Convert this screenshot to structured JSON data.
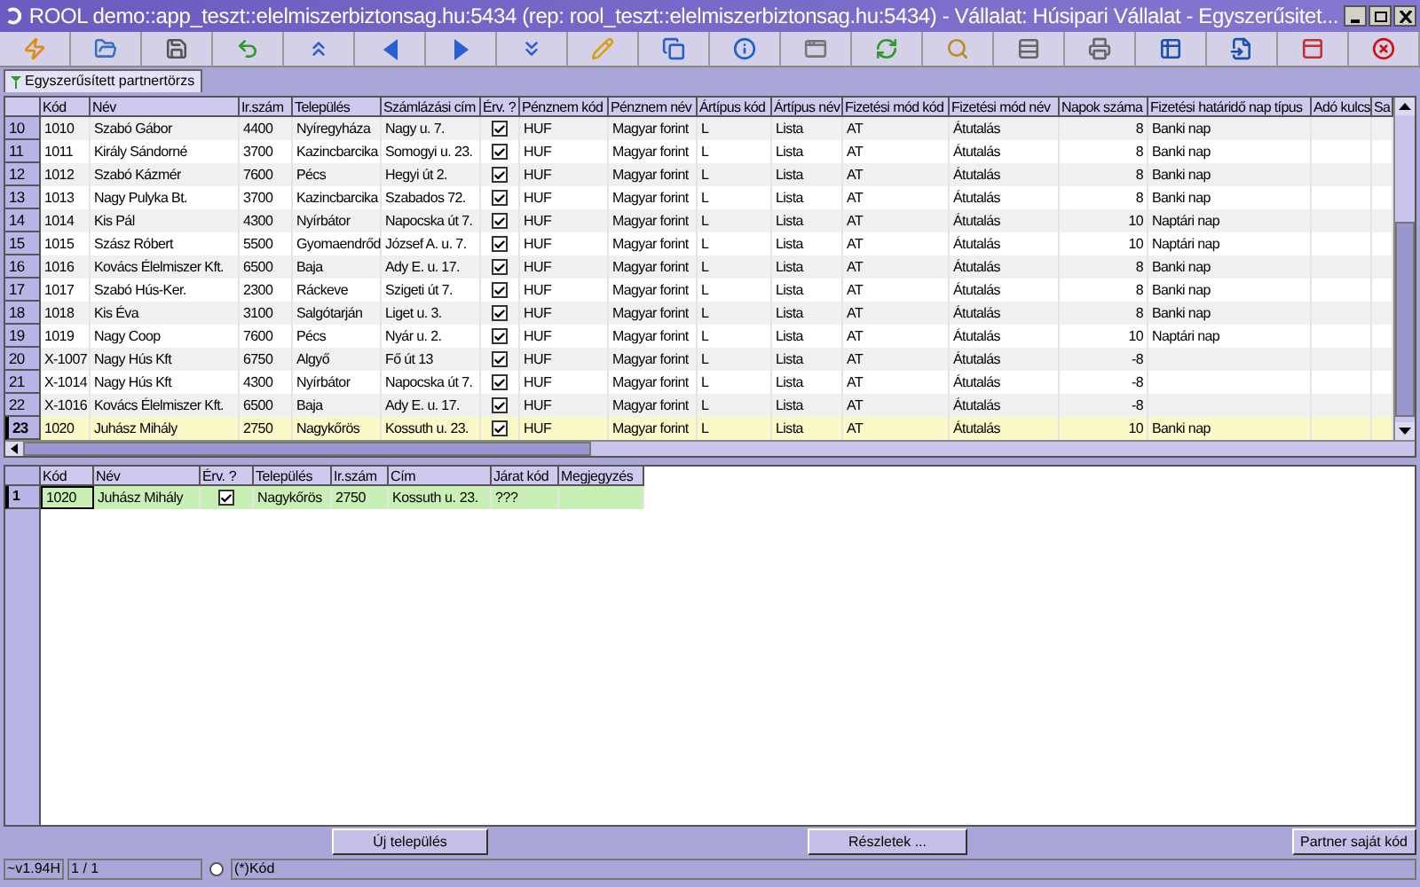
{
  "window": {
    "title": "ROOL demo::app_teszt::elelmiszerbiztonsag.hu:5434 (rep: rool_teszt::elelmiszerbiztonsag.hu:5434) - Vállalat: Húsipari Vállalat - Egyszerűsitet..."
  },
  "tabs": [
    {
      "label": "Egyszerűsített partnertörzs",
      "selected": true
    }
  ],
  "table": {
    "columns": [
      "Kód",
      "Név",
      "Ir.szám",
      "Település",
      "Számlázási cím",
      "Érv. ?",
      "Pénznem kód",
      "Pénznem név",
      "Ártípus kód",
      "Ártípus név",
      "Fizetési mód kód",
      "Fizetési mód név",
      "Napok száma",
      "Fizetési határidő nap típus",
      "Adó kulcs",
      "Sa"
    ],
    "rows": [
      {
        "num": "10",
        "cells": [
          "1010",
          "Szabó Gábor",
          "4400",
          "Nyíregyháza",
          "Nagy u. 7.",
          "",
          "HUF",
          "Magyar forint",
          "L",
          "Lista",
          "AT",
          "Átutalás",
          "8",
          "Banki nap"
        ],
        "valid": true,
        "selected": false
      },
      {
        "num": "11",
        "cells": [
          "1011",
          "Király Sándorné",
          "3700",
          "Kazincbarcika",
          "Somogyi u. 23.",
          "",
          "HUF",
          "Magyar forint",
          "L",
          "Lista",
          "AT",
          "Átutalás",
          "8",
          "Banki nap"
        ],
        "valid": true,
        "selected": false
      },
      {
        "num": "12",
        "cells": [
          "1012",
          "Szabó Kázmér",
          "7600",
          "Pécs",
          "Hegyi út 2.",
          "",
          "HUF",
          "Magyar forint",
          "L",
          "Lista",
          "AT",
          "Átutalás",
          "8",
          "Banki nap"
        ],
        "valid": true,
        "selected": false
      },
      {
        "num": "13",
        "cells": [
          "1013",
          "Nagy Pulyka Bt.",
          "3700",
          "Kazincbarcika",
          "Szabados 72.",
          "",
          "HUF",
          "Magyar forint",
          "L",
          "Lista",
          "AT",
          "Átutalás",
          "8",
          "Banki nap"
        ],
        "valid": true,
        "selected": false
      },
      {
        "num": "14",
        "cells": [
          "1014",
          "Kis Pál",
          "4300",
          "Nyírbátor",
          "Napocska út 7.",
          "",
          "HUF",
          "Magyar forint",
          "L",
          "Lista",
          "AT",
          "Átutalás",
          "10",
          "Naptári nap"
        ],
        "valid": true,
        "selected": false
      },
      {
        "num": "15",
        "cells": [
          "1015",
          "Szász Róbert",
          "5500",
          "Gyomaendrőd",
          "József A. u. 7.",
          "",
          "HUF",
          "Magyar forint",
          "L",
          "Lista",
          "AT",
          "Átutalás",
          "10",
          "Naptári nap"
        ],
        "valid": true,
        "selected": false
      },
      {
        "num": "16",
        "cells": [
          "1016",
          "Kovács Élelmiszer Kft.",
          "6500",
          "Baja",
          "Ady E. u. 17.",
          "",
          "HUF",
          "Magyar forint",
          "L",
          "Lista",
          "AT",
          "Átutalás",
          "8",
          "Banki nap"
        ],
        "valid": true,
        "selected": false
      },
      {
        "num": "17",
        "cells": [
          "1017",
          "Szabó Hús-Ker.",
          "2300",
          "Ráckeve",
          "Szigeti út 7.",
          "",
          "HUF",
          "Magyar forint",
          "L",
          "Lista",
          "AT",
          "Átutalás",
          "8",
          "Banki nap"
        ],
        "valid": true,
        "selected": false
      },
      {
        "num": "18",
        "cells": [
          "1018",
          "Kis Éva",
          "3100",
          "Salgótarján",
          "Liget u. 3.",
          "",
          "HUF",
          "Magyar forint",
          "L",
          "Lista",
          "AT",
          "Átutalás",
          "8",
          "Banki nap"
        ],
        "valid": true,
        "selected": false
      },
      {
        "num": "19",
        "cells": [
          "1019",
          "Nagy Coop",
          "7600",
          "Pécs",
          "Nyár u. 2.",
          "",
          "HUF",
          "Magyar forint",
          "L",
          "Lista",
          "AT",
          "Átutalás",
          "10",
          "Naptári nap"
        ],
        "valid": true,
        "selected": false
      },
      {
        "num": "20",
        "cells": [
          "X-1007",
          "Nagy Hús Kft",
          "6750",
          "Algyő",
          "Fő út 13",
          "",
          "HUF",
          "Magyar forint",
          "L",
          "Lista",
          "AT",
          "Átutalás",
          "-8"
        ],
        "valid": true,
        "selected": false
      },
      {
        "num": "21",
        "cells": [
          "X-1014",
          "Nagy Hús Kft",
          "4300",
          "Nyírbátor",
          "Napocska út 7.",
          "",
          "HUF",
          "Magyar forint",
          "L",
          "Lista",
          "AT",
          "Átutalás",
          "-8"
        ],
        "valid": true,
        "selected": false
      },
      {
        "num": "22",
        "cells": [
          "X-1016",
          "Kovács Élelmiszer Kft.",
          "6500",
          "Baja",
          "Ady E. u. 17.",
          "",
          "HUF",
          "Magyar forint",
          "L",
          "Lista",
          "AT",
          "Átutalás",
          "-8"
        ],
        "valid": true,
        "selected": false
      },
      {
        "num": "23",
        "cells": [
          "1020",
          "Juhász Mihály",
          "2750",
          "Nagykőrös",
          "Kossuth u. 23.",
          "",
          "HUF",
          "Magyar forint",
          "L",
          "Lista",
          "AT",
          "Átutalás",
          "10",
          "Banki nap"
        ],
        "valid": true,
        "selected": true
      }
    ]
  },
  "detail_table": {
    "columns": [
      "Kód",
      "Név",
      "Érv. ?",
      "Település",
      "Ir.szám",
      "Cím",
      "Járat kód",
      "Megjegyzés"
    ],
    "rows": [
      {
        "num": "1",
        "cells": [
          "1020",
          "Juhász Mihály",
          "",
          "Nagykőrös",
          "2750",
          "Kossuth u. 23.",
          "???"
        ],
        "valid": true,
        "selected": true
      }
    ]
  },
  "buttons": [
    "Új település",
    "Részletek ...",
    "Partner saját kód"
  ],
  "status_bar": {
    "version": "~v1.94H",
    "record": "1 / 1",
    "radio_selected": false,
    "label": "(*)Kód"
  }
}
